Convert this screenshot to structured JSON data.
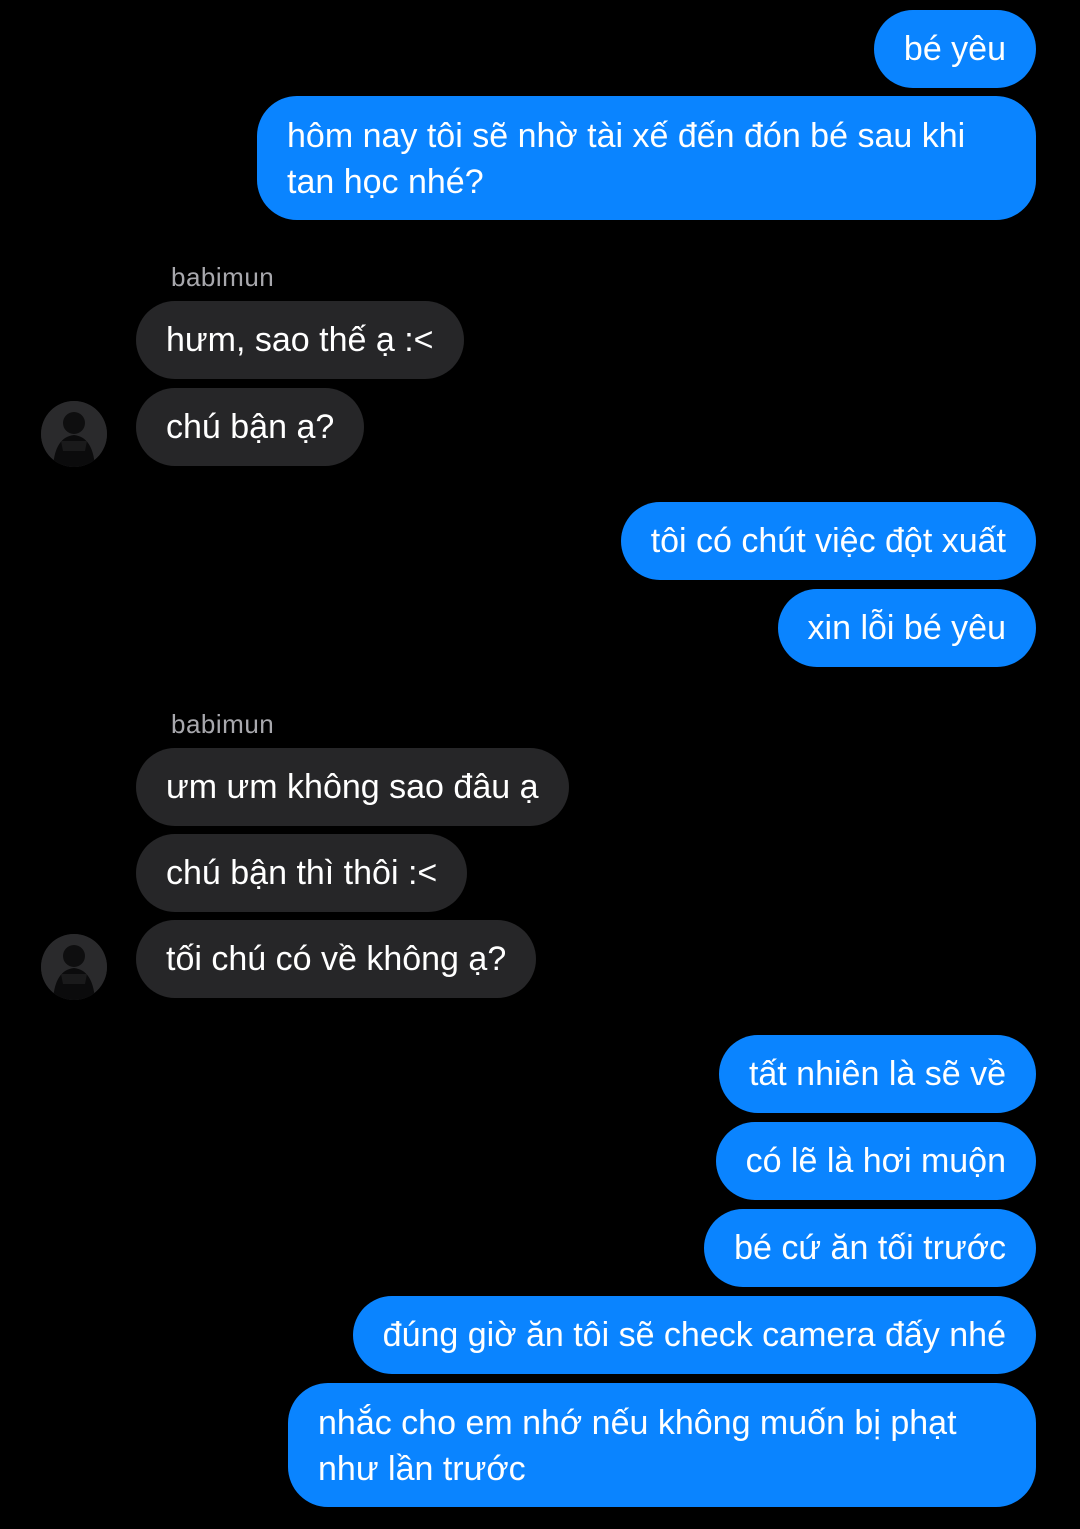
{
  "colors": {
    "background": "#000000",
    "outgoing_bubble": "#0a84ff",
    "incoming_bubble": "#262628",
    "sender_name": "#a8a8ad"
  },
  "thread": {
    "m1": "bé yêu",
    "m2": "hôm nay tôi sẽ nhờ tài xế đến đón bé sau khi tan học nhé?",
    "g1_sender": "babimun",
    "m3": "hưm, sao thế ạ :<",
    "m4": "chú bận ạ?",
    "m5": "tôi có chút việc đột xuất",
    "m6": "xin lỗi bé yêu",
    "g2_sender": "babimun",
    "m7": "ưm ưm không sao đâu ạ",
    "m8": "chú bận thì thôi :<",
    "m9": "tối chú có về không ạ?",
    "m10": "tất nhiên là sẽ về",
    "m11": "có lẽ là hơi muộn",
    "m12": "bé cứ ăn tối trước",
    "m13": "đúng giờ ăn tôi sẽ check camera đấy nhé",
    "m14": "nhắc cho em nhớ nếu không muốn bị phạt như lần trước"
  },
  "icons": {
    "avatar": "profile-photo"
  }
}
